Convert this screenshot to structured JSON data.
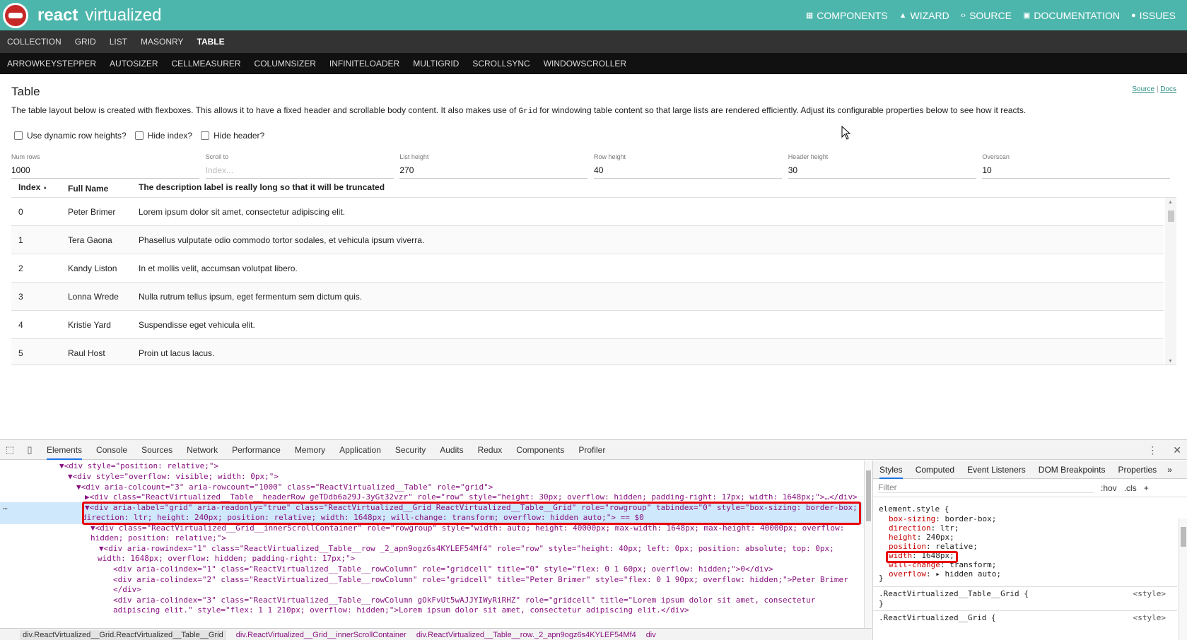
{
  "header": {
    "brand_a": "react",
    "brand_b": "virtualized",
    "nav": [
      {
        "icon": "grid-icon",
        "glyph": "▦",
        "label": "COMPONENTS"
      },
      {
        "icon": "wizard-icon",
        "glyph": "▲",
        "label": "WIZARD"
      },
      {
        "icon": "code-icon",
        "glyph": "‹›",
        "label": "SOURCE"
      },
      {
        "icon": "book-icon",
        "glyph": "▣",
        "label": "DOCUMENTATION"
      },
      {
        "icon": "bug-icon",
        "glyph": "●",
        "label": "ISSUES"
      }
    ]
  },
  "nav1": [
    "COLLECTION",
    "GRID",
    "LIST",
    "MASONRY",
    "TABLE"
  ],
  "nav1_active": "TABLE",
  "nav2": [
    "ARROWKEYSTEPPER",
    "AUTOSIZER",
    "CELLMEASURER",
    "COLUMNSIZER",
    "INFINITELOADER",
    "MULTIGRID",
    "SCROLLSYNC",
    "WINDOWSCROLLER"
  ],
  "page": {
    "title": "Table",
    "source_link": "Source",
    "sep": "|",
    "docs_link": "Docs",
    "desc_a": "The table layout below is created with flexboxes. This allows it to have a fixed header and scrollable body content. It also makes use of",
    "desc_code": "Grid",
    "desc_b": "for windowing table content so that large lists are rendered efficiently. Adjust its configurable properties below to see how it reacts.",
    "checks": [
      "Use dynamic row heights?",
      "Hide index?",
      "Hide header?"
    ],
    "fields": [
      {
        "label": "Num rows",
        "value": "1000",
        "placeholder": ""
      },
      {
        "label": "Scroll to",
        "value": "",
        "placeholder": "Index..."
      },
      {
        "label": "List height",
        "value": "270",
        "placeholder": ""
      },
      {
        "label": "Row height",
        "value": "40",
        "placeholder": ""
      },
      {
        "label": "Header height",
        "value": "30",
        "placeholder": ""
      },
      {
        "label": "Overscan",
        "value": "10",
        "placeholder": ""
      }
    ]
  },
  "table": {
    "headers": [
      "Index",
      "Full Name",
      "The description label is really long so that it will be truncated"
    ],
    "sort_glyph": "▲",
    "rows": [
      {
        "index": "0",
        "name": "Peter Brimer",
        "desc": "Lorem ipsum dolor sit amet, consectetur adipiscing elit."
      },
      {
        "index": "1",
        "name": "Tera Gaona",
        "desc": "Phasellus vulputate odio commodo tortor sodales, et vehicula ipsum viverra."
      },
      {
        "index": "2",
        "name": "Kandy Liston",
        "desc": "In et mollis velit, accumsan volutpat libero."
      },
      {
        "index": "3",
        "name": "Lonna Wrede",
        "desc": "Nulla rutrum tellus ipsum, eget fermentum sem dictum quis."
      },
      {
        "index": "4",
        "name": "Kristie Yard",
        "desc": "Suspendisse eget vehicula elit."
      },
      {
        "index": "5",
        "name": "Raul Host",
        "desc": "Proin ut lacus lacus."
      }
    ]
  },
  "devtools": {
    "tabs": [
      "Elements",
      "Console",
      "Sources",
      "Network",
      "Performance",
      "Memory",
      "Application",
      "Security",
      "Audits",
      "Redux",
      "Components",
      "Profiler"
    ],
    "active_tab": "Elements",
    "dom_lines": [
      "▼<div style=\"position: relative;\">",
      "▼<div style=\"overflow: visible; width: 0px;\">",
      "▼<div aria-colcount=\"3\" aria-rowcount=\"1000\" class=\"ReactVirtualized__Table\" role=\"grid\">",
      "▶<div class=\"ReactVirtualized__Table__headerRow geTDdb6a29J-3yGt32vzr\" role=\"row\" style=\"height: 30px; overflow: hidden; padding-right: 17px; width: 1648px;\">…</div>",
      "▼<div aria-label=\"grid\" aria-readonly=\"true\" class=\"ReactVirtualized__Grid ReactVirtualized__Table__Grid\" role=\"rowgroup\" tabindex=\"0\" style=\"box-sizing: border-box;",
      "direction: ltr; height: 240px; position: relative; width: 1648px; will-change: transform; overflow: hidden auto;\"> == $0",
      "▼<div class=\"ReactVirtualized__Grid__innerScrollContainer\" role=\"rowgroup\" style=\"width: auto; height: 40000px; max-width: 1648px; max-height: 40000px; overflow:",
      "hidden; position: relative;\">",
      "▼<div aria-rowindex=\"1\" class=\"ReactVirtualized__Table__row _2_apn9ogz6s4KYLEF54Mf4\" role=\"row\" style=\"height: 40px; left: 0px; position: absolute; top: 0px;",
      "width: 1648px; overflow: hidden; padding-right: 17px;\">",
      "<div aria-colindex=\"1\" class=\"ReactVirtualized__Table__rowColumn\" role=\"gridcell\" title=\"0\" style=\"flex: 0 1 60px; overflow: hidden;\">0</div>",
      "<div aria-colindex=\"2\" class=\"ReactVirtualized__Table__rowColumn\" role=\"gridcell\" title=\"Peter Brimer\" style=\"flex: 0 1 90px; overflow: hidden;\">Peter Brimer",
      "</div>",
      "<div aria-colindex=\"3\" class=\"ReactVirtualized__Table__rowColumn gOkFvUt5wAJJYIWyRiRHZ\" role=\"gridcell\" title=\"Lorem ipsum dolor sit amet, consectetur",
      "adipiscing elit.\" style=\"flex: 1 1 210px; overflow: hidden;\">Lorem ipsum dolor sit amet, consectetur adipiscing elit.</div>"
    ],
    "gutter_dots": "…",
    "crumbs": [
      "div.ReactVirtualized__Grid.ReactVirtualized__Table__Grid",
      "div.ReactVirtualized__Grid__innerScrollContainer",
      "div.ReactVirtualized__Table__row._2_apn9ogz6s4KYLEF54Mf4",
      "div"
    ],
    "styles_tabs": [
      "Styles",
      "Computed",
      "Event Listeners",
      "DOM Breakpoints",
      "Properties"
    ],
    "styles_more": "»",
    "filter_placeholder": "Filter",
    "filter_tools": [
      ":hov",
      ".cls",
      "+"
    ],
    "element_style": "element.style {",
    "element_props": [
      {
        "p": "box-sizing",
        "v": "border-box;"
      },
      {
        "p": "direction",
        "v": "ltr;"
      },
      {
        "p": "height",
        "v": "240px;"
      },
      {
        "p": "position",
        "v": "relative;"
      },
      {
        "p": "width",
        "v": "1648px;"
      },
      {
        "p": "will-change",
        "v": "transform;"
      },
      {
        "p": "overflow",
        "v": "▸ hidden auto;"
      }
    ],
    "close_brace": "}",
    "rule1": ".ReactVirtualized__Table__Grid {",
    "rule2": ".ReactVirtualized__Grid {",
    "style_src": "<style>"
  }
}
